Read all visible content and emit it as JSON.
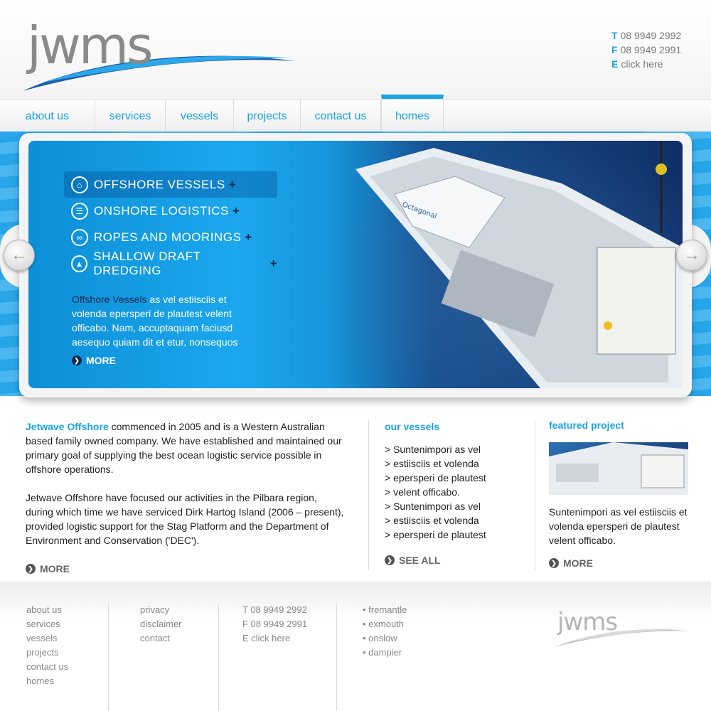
{
  "brand": {
    "logo_text": "jwms"
  },
  "contact": {
    "phone_key": "T",
    "phone": "08 9949 2992",
    "fax_key": "F",
    "fax": "08 9949 2991",
    "email_key": "E",
    "email": "click here"
  },
  "nav": {
    "items": [
      {
        "label": "about us"
      },
      {
        "label": "services"
      },
      {
        "label": "vessels"
      },
      {
        "label": "projects"
      },
      {
        "label": "contact us"
      },
      {
        "label": "homes"
      }
    ],
    "active_index": 5
  },
  "hero": {
    "menu": [
      {
        "label": "OFFSHORE VESSELS",
        "plus": "+"
      },
      {
        "label": "ONSHORE LOGISTICS",
        "plus": "+"
      },
      {
        "label": "ROPES AND MOORINGS",
        "plus": "+"
      },
      {
        "label": "SHALLOW DRAFT DREDGING",
        "plus": "+"
      }
    ],
    "desc_highlight": "Offshore Vessels",
    "desc_rest": " as vel estiisciis et volenda epersperi de plautest velent officabo. Nam, accuptaquam faciusd aesequo quiam dit et etur, nonsequos",
    "more_label": "MORE",
    "boat_name": "Octagonal"
  },
  "about": {
    "company": "Jetwave Offshore",
    "para1_rest": " commenced in 2005 and is a Western Australian based family owned company. We have established and maintained our primary goal of supplying the best ocean logistic service possible in offshore operations.",
    "para2": "Jetwave Offshore have focused our activities in the Pilbara region, during which time we have serviced Dirk Hartog Island (2006 – present), provided logistic support for the Stag Platform and the Department of Environment and Conservation ('DEC').",
    "more_label": "MORE"
  },
  "vessels": {
    "heading": "our vessels",
    "items": [
      "> Suntenimpori as vel",
      "> estiisciis et volenda",
      "> epersperi de plautest",
      "> velent officabo.",
      "> Suntenimpori as vel",
      "> estiisciis et volenda",
      "> epersperi de plautest"
    ],
    "see_all_label": "SEE ALL"
  },
  "featured": {
    "heading": "featured project",
    "text": "Suntenimpori as vel estiisciis et volenda epersperi de plautest velent officabo.",
    "more_label": "MORE"
  },
  "footer": {
    "nav": [
      "about us",
      "services",
      "vessels",
      "projects",
      "contact us",
      "homes"
    ],
    "legal": [
      "privacy",
      "disclaimer",
      "contact"
    ],
    "contact": [
      "T 08 9949 2992",
      "F 08 9949 2991",
      "E click here"
    ],
    "locations": [
      "• fremantle",
      "• exmouth",
      "• onslow",
      "• dampier"
    ],
    "logo_text": "jwms"
  },
  "colors": {
    "accent": "#1aa3e6",
    "dark_navy": "#0b2a4f",
    "text": "#222222",
    "muted": "#888888"
  }
}
